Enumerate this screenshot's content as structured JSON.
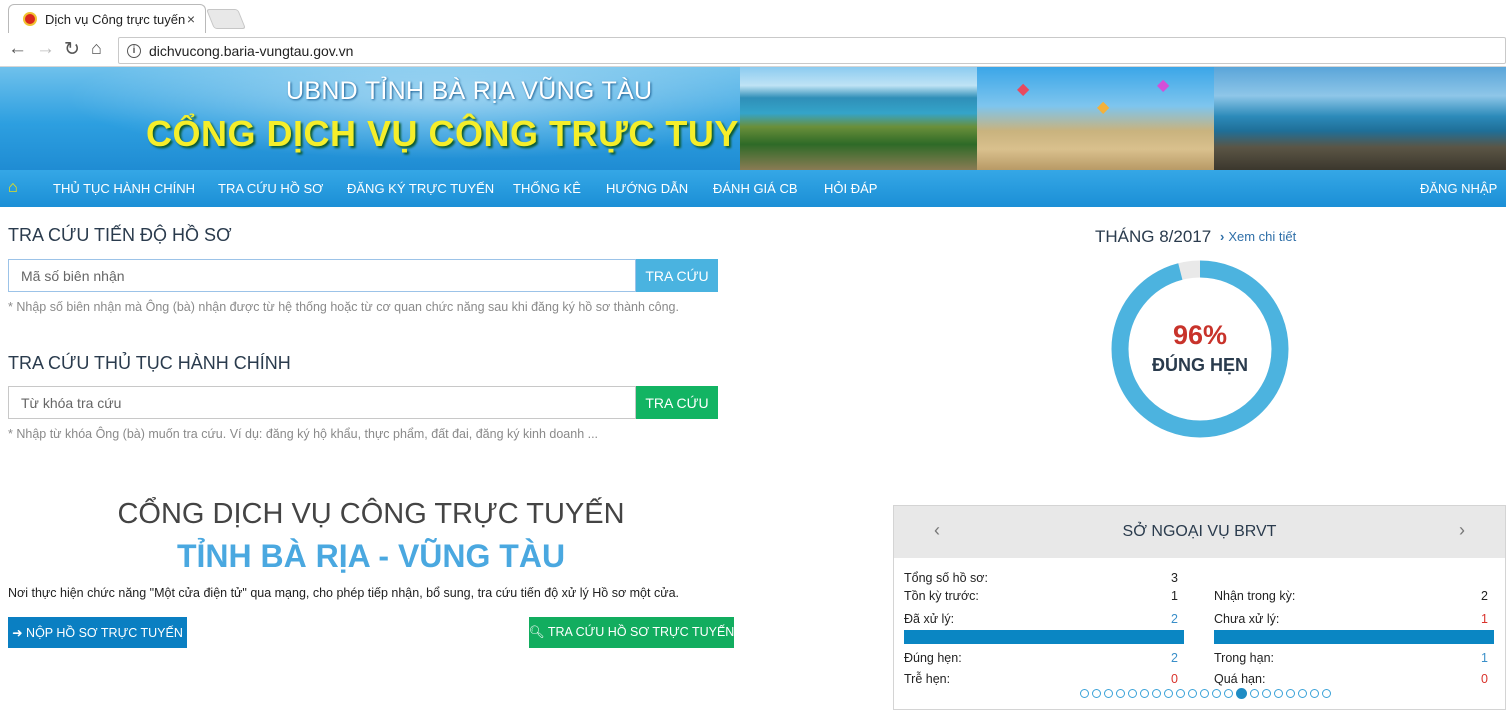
{
  "browser": {
    "tab_title": "Dịch vụ Công trực tuyến",
    "tab_close": "×",
    "url": "dichvucong.baria-vungtau.gov.vn",
    "info_icon": "i"
  },
  "banner": {
    "top": "UBND TỈNH BÀ RỊA VŨNG TÀU",
    "main": "CỔNG DỊCH VỤ CÔNG TRỰC TUYẾN"
  },
  "menu": {
    "items": [
      "THỦ TỤC HÀNH CHÍNH",
      "TRA CỨU HỒ SƠ",
      "ĐĂNG KÝ TRỰC TUYẾN",
      "THỐNG KÊ",
      "HƯỚNG DẪN",
      "ĐÁNH GIÁ CB",
      "HỎI ĐÁP"
    ],
    "login": "ĐĂNG NHẬP"
  },
  "search_progress": {
    "title": "TRA CỨU TIẾN ĐỘ HỒ SƠ",
    "placeholder": "Mã số biên nhận",
    "button": "TRA CỨU",
    "hint": "* Nhập số biên nhận mà Ông (bà) nhận được từ hệ thống hoặc từ cơ quan chức năng sau khi đăng ký hồ sơ thành công."
  },
  "search_procedure": {
    "title": "TRA CỨU THỦ TỤC HÀNH CHÍNH",
    "placeholder": "Từ khóa tra cứu",
    "button": "TRA CỨU",
    "hint": "* Nhập từ khóa Ông (bà) muốn tra cứu. Ví dụ: đăng ký hộ khẩu, thực phẩm, đất đai, đăng ký kinh doanh ..."
  },
  "portal": {
    "title": "CỔNG DỊCH VỤ CÔNG TRỰC TUYẾN",
    "subtitle": "TỈNH BÀ RỊA - VŨNG TÀU",
    "description": "Nơi thực hiện chức năng \"Một cửa điện tử\" qua mạng, cho phép tiếp nhận, bổ sung, tra cứu tiến độ xử lý Hồ sơ một cửa.",
    "btn_submit": "➜ NỘP HỒ SƠ TRỰC TUYẾN",
    "btn_lookup": "🔍︎ TRA CỨU HỒ SƠ TRỰC TUYẾN"
  },
  "stats": {
    "month": "THÁNG 8/2017",
    "detail_link": "Xem chi tiết",
    "percent": 96,
    "percent_text": "96%",
    "percent_label": "ĐÚNG HẸN"
  },
  "agency": {
    "name": "SỞ NGOẠI VỤ BRVT",
    "total_label": "Tổng số hồ sơ:",
    "total": "3",
    "prev_label": "Tồn kỳ trước:",
    "prev": "1",
    "received_label": "Nhận trong kỳ:",
    "received": "2",
    "processed_label": "Đã xử lý:",
    "processed": "2",
    "unprocessed_label": "Chưa xử lý:",
    "unprocessed": "1",
    "ontime_label": "Đúng hẹn:",
    "ontime": "2",
    "inlimit_label": "Trong hạn:",
    "inlimit": "1",
    "late_label": "Trễ hẹn:",
    "late": "0",
    "overdue_label": "Quá hạn:",
    "overdue": "0",
    "page_count": 21,
    "active_page": 13
  },
  "colors": {
    "menu_blue": "#1b8fd6",
    "search_blue": "#4ab3e0",
    "search_green": "#12b463",
    "submit_blue": "#0a7fc2",
    "lookup_green": "#12ad5f",
    "donut_blue": "#4cb3df",
    "percent_red": "#c8332b",
    "value_blue": "#3a8fc9",
    "value_red": "#d9322b"
  }
}
